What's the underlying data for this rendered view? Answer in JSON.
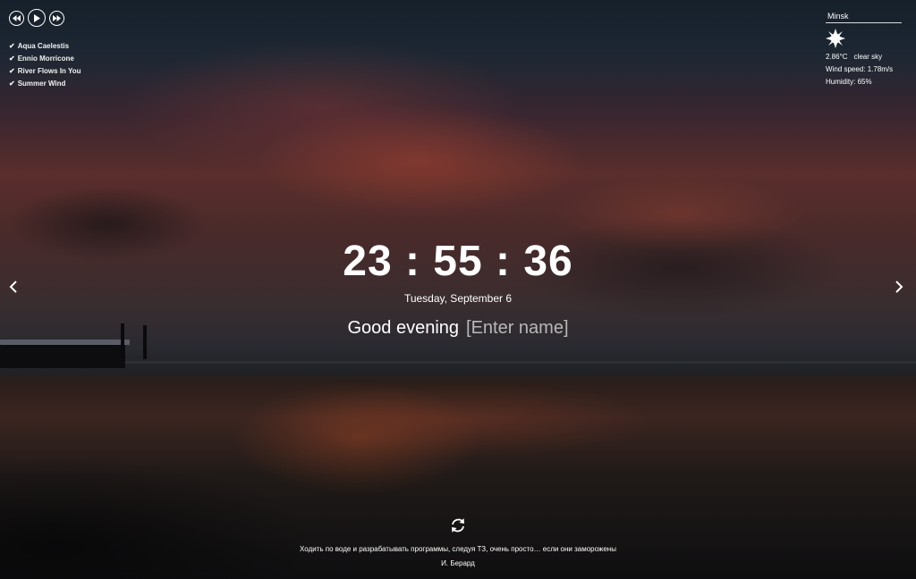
{
  "player": {
    "prev_icon": "prev-track-icon",
    "play_icon": "play-icon",
    "next_icon": "next-track-icon",
    "tracks": [
      {
        "check_icon": "checkmark-icon",
        "title": "Aqua Caelestis"
      },
      {
        "check_icon": "checkmark-icon",
        "title": "Ennio Morricone"
      },
      {
        "check_icon": "checkmark-icon",
        "title": "River Flows In You"
      },
      {
        "check_icon": "checkmark-icon",
        "title": "Summer Wind"
      }
    ]
  },
  "weather": {
    "city": "Minsk",
    "icon": "clear-sky-sun-icon",
    "temperature": "2.86°C",
    "description": "clear sky",
    "wind": "Wind speed: 1.78m/s",
    "humidity": "Humidity: 65%"
  },
  "clock": {
    "time": "23 : 55 : 36",
    "date": "Tuesday, September 6"
  },
  "greeting": {
    "text": "Good evening",
    "name_placeholder": "[Enter name]"
  },
  "slider": {
    "prev_icon": "chevron-left-icon",
    "next_icon": "chevron-right-icon"
  },
  "quote": {
    "refresh_icon": "refresh-icon",
    "text": "Ходить по воде и разрабатывать программы, следуя ТЗ, очень просто… если они заморожены",
    "author": "И. Берард"
  }
}
